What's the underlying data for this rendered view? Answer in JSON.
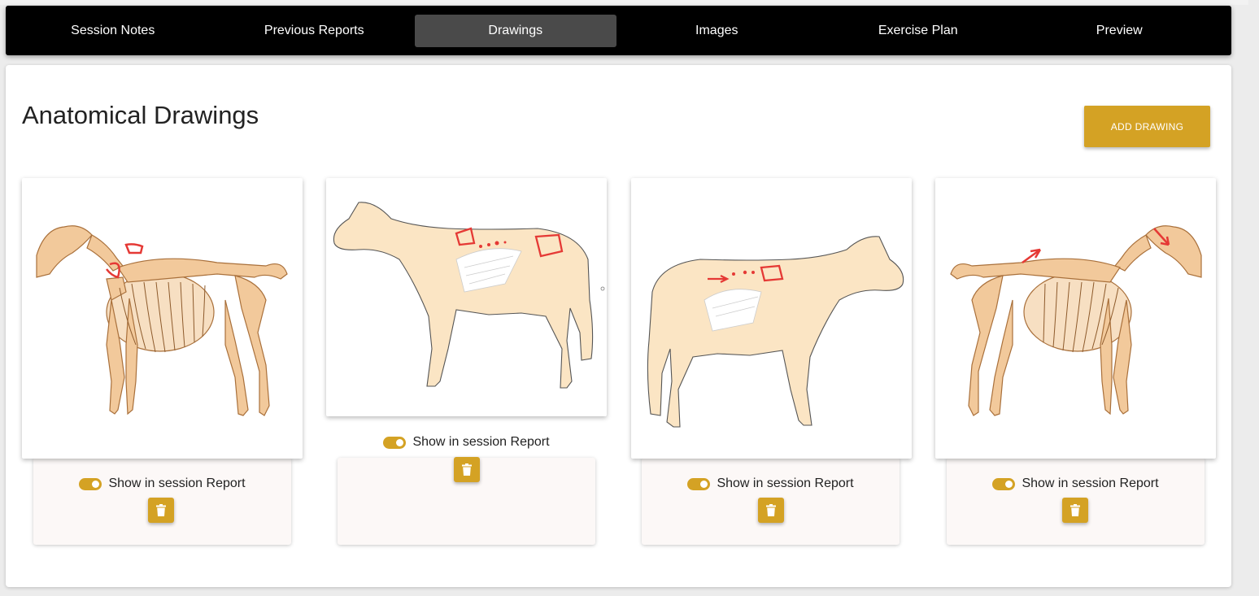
{
  "tabs": [
    {
      "label": "Session Notes",
      "active": false
    },
    {
      "label": "Previous Reports",
      "active": false
    },
    {
      "label": "Drawings",
      "active": true
    },
    {
      "label": "Images",
      "active": false
    },
    {
      "label": "Exercise Plan",
      "active": false
    },
    {
      "label": "Preview",
      "active": false
    }
  ],
  "page": {
    "title": "Anatomical Drawings",
    "add_button": "ADD DRAWING"
  },
  "drawings": [
    {
      "image": "horse-skeleton-left",
      "toggle_label": "Show in session Report",
      "toggle_on": true
    },
    {
      "image": "horse-muscle-left",
      "toggle_label": "Show in session Report",
      "toggle_on": true
    },
    {
      "image": "horse-muscle-right",
      "toggle_label": "Show in session Report",
      "toggle_on": true
    },
    {
      "image": "horse-skeleton-right",
      "toggle_label": "Show in session Report",
      "toggle_on": true
    }
  ],
  "colors": {
    "accent": "#d4a224",
    "nav_bg": "#000000",
    "nav_active": "#4a4a4a",
    "markup_red": "#e53935",
    "bone": "#f2c99b"
  }
}
